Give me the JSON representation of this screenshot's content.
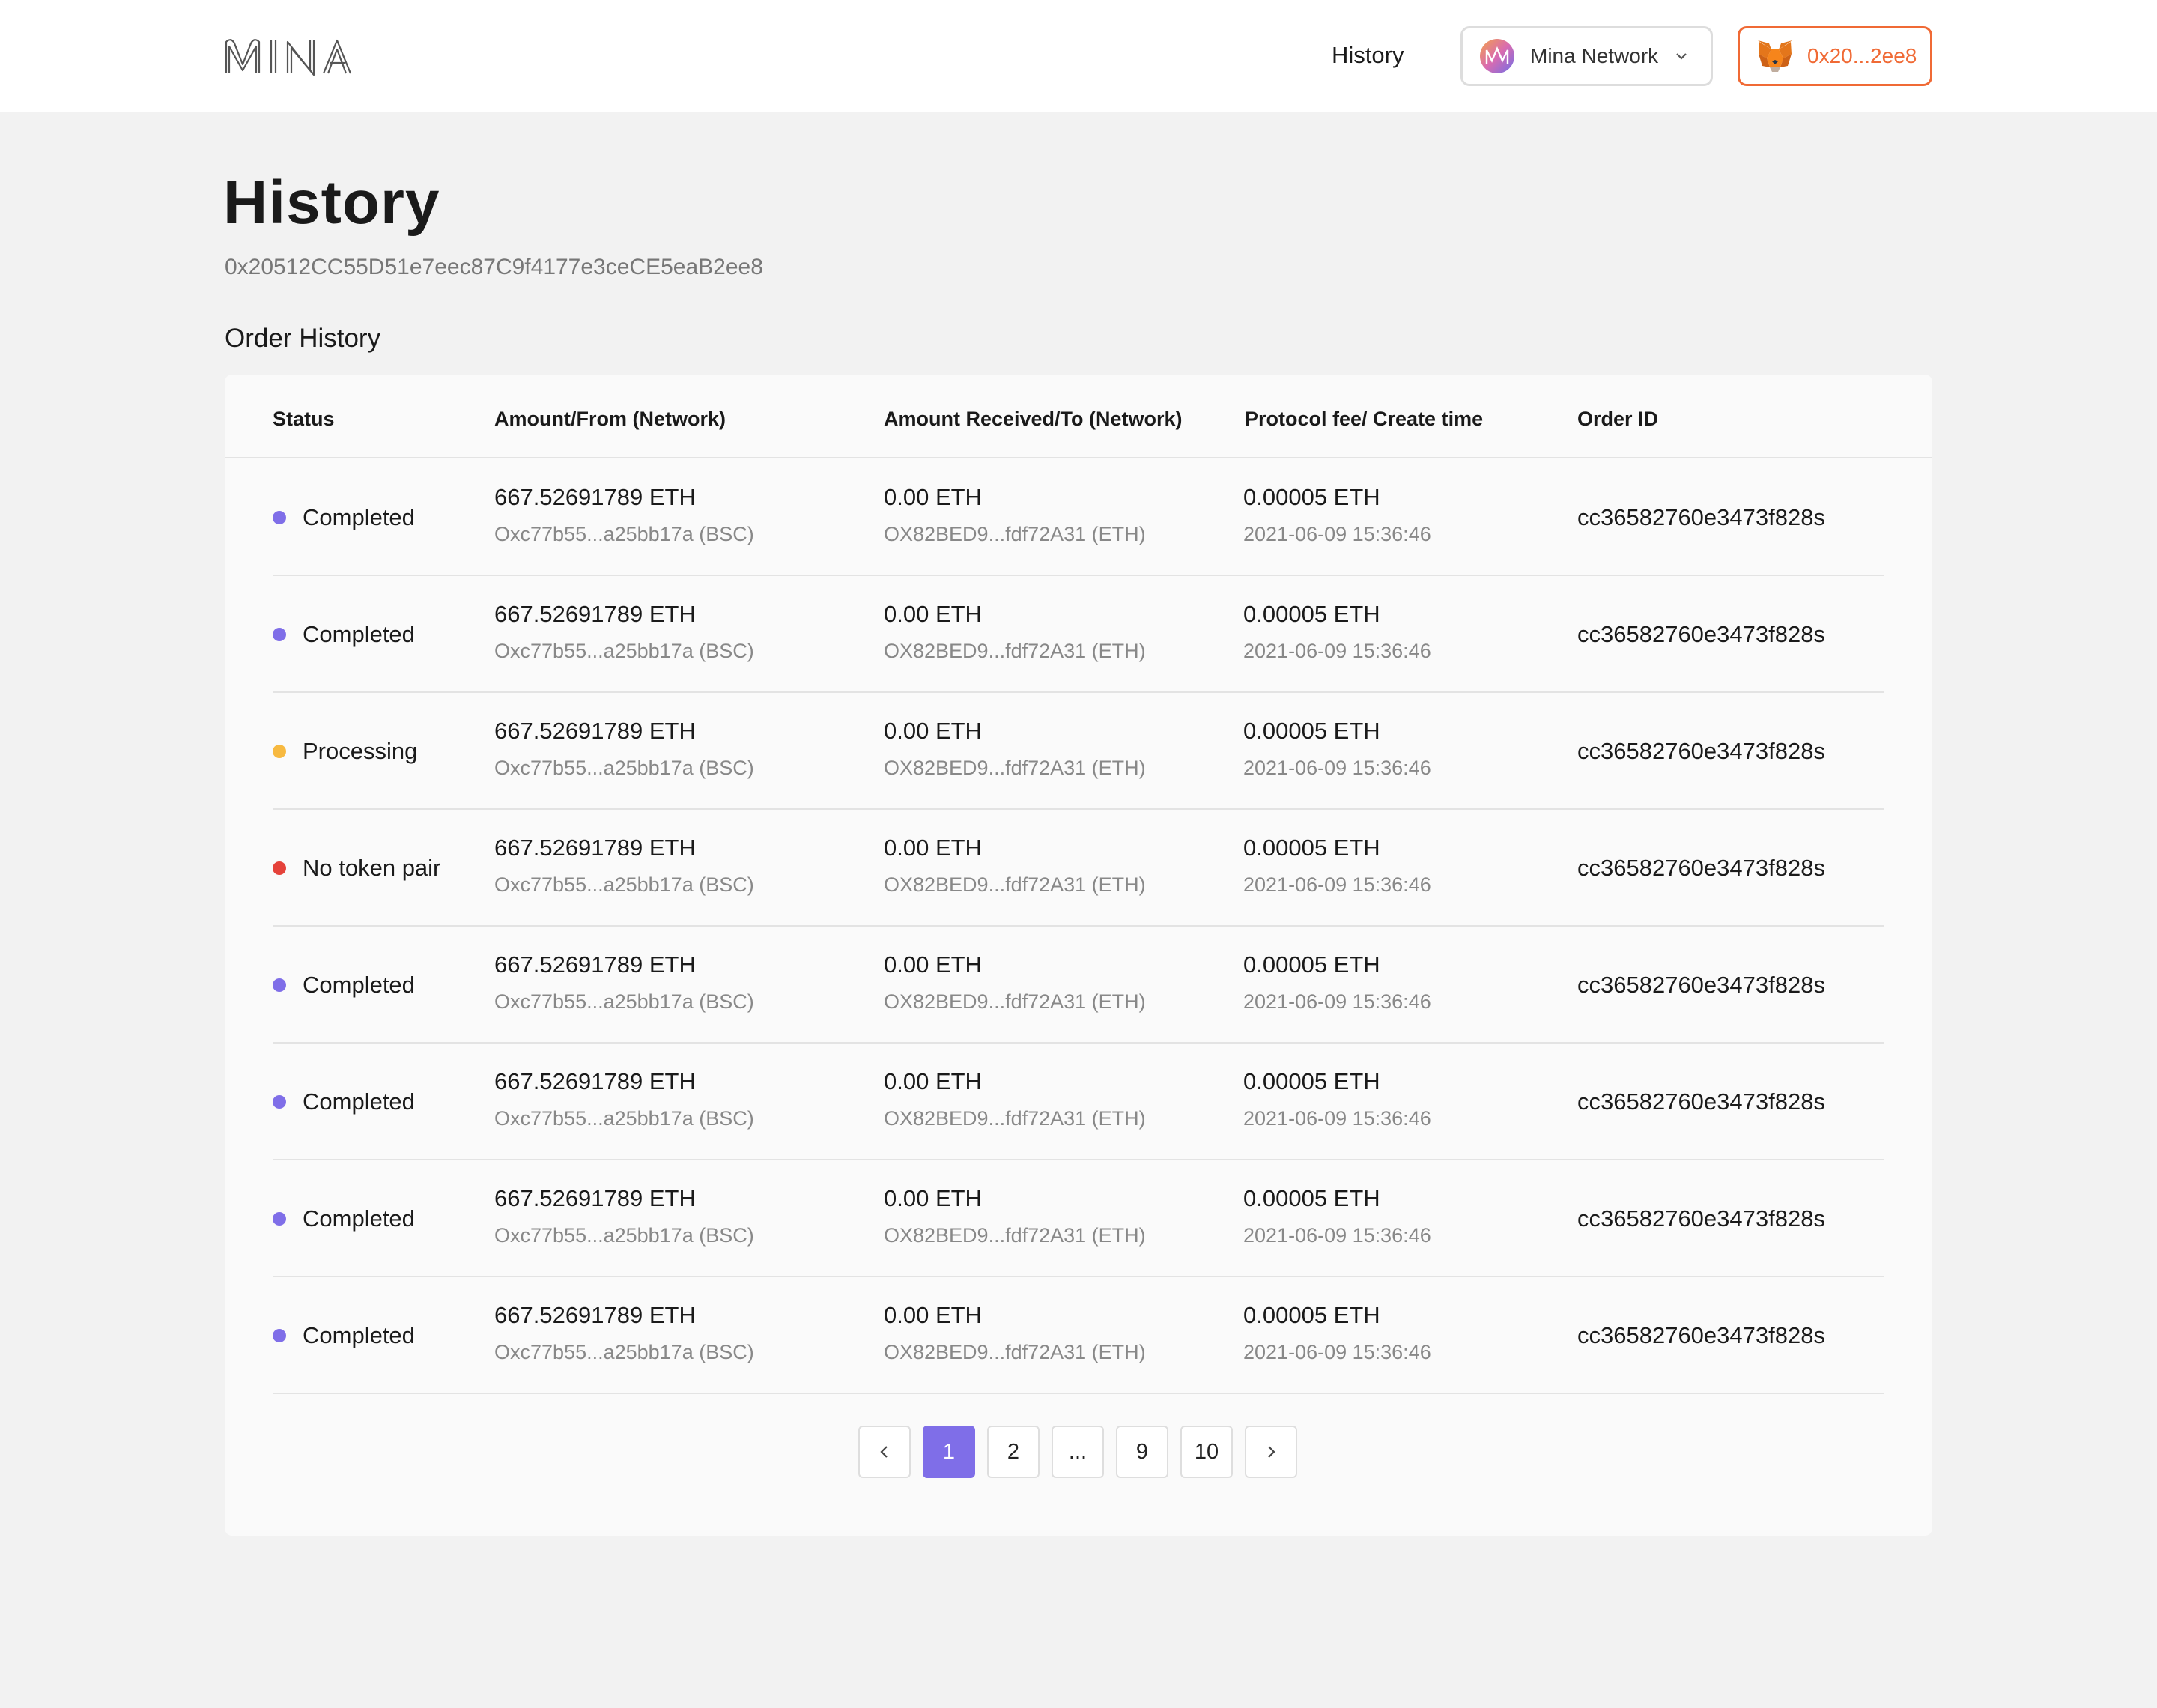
{
  "header": {
    "logo_text": "MINA",
    "nav_history": "History",
    "network_label": "Mina Network",
    "wallet_short": "0x20...2ee8",
    "accent_color": "#f06a35"
  },
  "page": {
    "title": "History",
    "address": "0x20512CC55D51e7eec87C9f4177e3ceCE5eaB2ee8",
    "section_title": "Order History"
  },
  "table": {
    "columns": [
      "Status",
      "Amount/From (Network)",
      "Amount Received/To (Network)",
      "Protocol fee/ Create time",
      "Order ID"
    ],
    "rows": [
      {
        "status": "Completed",
        "status_color": "#7f6ee8",
        "amount": "667.52691789 ETH",
        "from": "Oxc77b55...a25bb17a (BSC)",
        "received": "0.00 ETH",
        "to": "OX82BED9...fdf72A31 (ETH)",
        "fee": "0.00005 ETH",
        "time": "2021-06-09 15:36:46",
        "order_id": "cc36582760e3473f828s"
      },
      {
        "status": "Completed",
        "status_color": "#7f6ee8",
        "amount": "667.52691789 ETH",
        "from": "Oxc77b55...a25bb17a (BSC)",
        "received": "0.00 ETH",
        "to": "OX82BED9...fdf72A31 (ETH)",
        "fee": "0.00005 ETH",
        "time": "2021-06-09 15:36:46",
        "order_id": "cc36582760e3473f828s"
      },
      {
        "status": "Processing",
        "status_color": "#f7b940",
        "amount": "667.52691789 ETH",
        "from": "Oxc77b55...a25bb17a (BSC)",
        "received": "0.00 ETH",
        "to": "OX82BED9...fdf72A31 (ETH)",
        "fee": "0.00005 ETH",
        "time": "2021-06-09 15:36:46",
        "order_id": "cc36582760e3473f828s"
      },
      {
        "status": "No token pair",
        "status_color": "#e5423a",
        "amount": "667.52691789 ETH",
        "from": "Oxc77b55...a25bb17a (BSC)",
        "received": "0.00 ETH",
        "to": "OX82BED9...fdf72A31 (ETH)",
        "fee": "0.00005 ETH",
        "time": "2021-06-09 15:36:46",
        "order_id": "cc36582760e3473f828s"
      },
      {
        "status": "Completed",
        "status_color": "#7f6ee8",
        "amount": "667.52691789 ETH",
        "from": "Oxc77b55...a25bb17a (BSC)",
        "received": "0.00 ETH",
        "to": "OX82BED9...fdf72A31 (ETH)",
        "fee": "0.00005 ETH",
        "time": "2021-06-09 15:36:46",
        "order_id": "cc36582760e3473f828s"
      },
      {
        "status": "Completed",
        "status_color": "#7f6ee8",
        "amount": "667.52691789 ETH",
        "from": "Oxc77b55...a25bb17a (BSC)",
        "received": "0.00 ETH",
        "to": "OX82BED9...fdf72A31 (ETH)",
        "fee": "0.00005 ETH",
        "time": "2021-06-09 15:36:46",
        "order_id": "cc36582760e3473f828s"
      },
      {
        "status": "Completed",
        "status_color": "#7f6ee8",
        "amount": "667.52691789 ETH",
        "from": "Oxc77b55...a25bb17a (BSC)",
        "received": "0.00 ETH",
        "to": "OX82BED9...fdf72A31 (ETH)",
        "fee": "0.00005 ETH",
        "time": "2021-06-09 15:36:46",
        "order_id": "cc36582760e3473f828s"
      },
      {
        "status": "Completed",
        "status_color": "#7f6ee8",
        "amount": "667.52691789 ETH",
        "from": "Oxc77b55...a25bb17a (BSC)",
        "received": "0.00 ETH",
        "to": "OX82BED9...fdf72A31 (ETH)",
        "fee": "0.00005 ETH",
        "time": "2021-06-09 15:36:46",
        "order_id": "cc36582760e3473f828s"
      }
    ]
  },
  "pagination": {
    "prev_icon": "chevron-left-icon",
    "next_icon": "chevron-right-icon",
    "pages": [
      "1",
      "2",
      "...",
      "9",
      "10"
    ],
    "active": "1",
    "active_color": "#7f6ee8"
  }
}
